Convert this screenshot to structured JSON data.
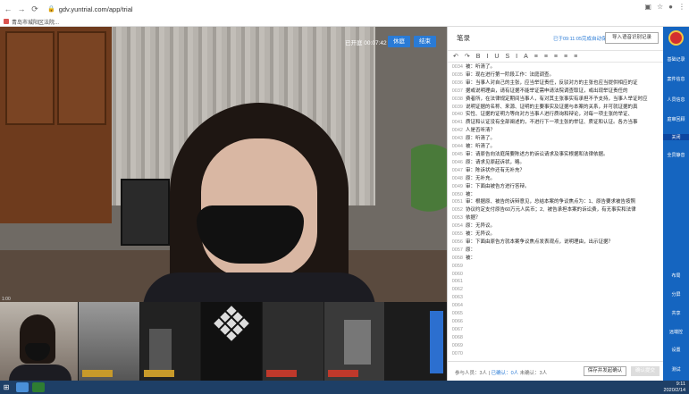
{
  "browser": {
    "url": "gdv.yuntrial.com/app/trial",
    "bookmark": "青岛市城阳区法院..."
  },
  "video": {
    "timestamp": "已开庭 00:07:42",
    "pause_label": "休庭",
    "end_label": "结束",
    "coord": "1:00"
  },
  "thumbnails": [
    {
      "tag": ""
    },
    {
      "tag": ""
    },
    {
      "tag": ""
    },
    {
      "tag": ""
    },
    {
      "tag": ""
    },
    {
      "tag": ""
    },
    {
      "tag": ""
    }
  ],
  "transcript": {
    "title": "笔录",
    "save_note": "已于09:11:05完成自动保存",
    "import_label": "导入语音识别记录",
    "toolbar": [
      "↶",
      "↷",
      "B",
      "I",
      "U",
      "S",
      "I",
      "A",
      "≡",
      "≡",
      "≡",
      "≡",
      "≡"
    ],
    "lines": [
      {
        "n": "0034",
        "t": "被：听清了。"
      },
      {
        "n": "0035",
        "t": "审：现在进行第一阶段工作：法庭调查。"
      },
      {
        "n": "0036",
        "t": "审：当事人对自己的主张，应当举证责任，反驳对方的主张也应当提供相应的证"
      },
      {
        "n": "0037",
        "t": "据或说明理由，请有证据不能举证需申请法院调查取证，或出现举证责任的"
      },
      {
        "n": "0038",
        "t": "费者所，在法律规定期间当事人，有对其主张事实有承担不予支持，当事人举证时应"
      },
      {
        "n": "0039",
        "t": "说明证据的名称、来源、证明的主要事实及证据与本案的关系，并可就证据的真"
      },
      {
        "n": "0040",
        "t": "实性、证据的证明力等向对方当事人进行质询和辩论，对每一项主张的举证、"
      },
      {
        "n": "0041",
        "t": "质证和认证没有全部阐述的，不进行下一项主张的举证、质证和认证。各方当事"
      },
      {
        "n": "0042",
        "t": "人是否听清？"
      },
      {
        "n": "0043",
        "t": "原：听清了。"
      },
      {
        "n": "0044",
        "t": "被：听清了。"
      },
      {
        "n": "0045",
        "t": "审：请原告向法庭简要陈述方的诉讼请求及事实根据和法律依据。"
      },
      {
        "n": "0046",
        "t": "原：请求见原起诉状，略。"
      },
      {
        "n": "0047",
        "t": "审：陈诉状作还有无补充？"
      },
      {
        "n": "0048",
        "t": "原：无补充。"
      },
      {
        "n": "0049",
        "t": "审：下面由被告方进行答辩。"
      },
      {
        "n": "0050",
        "t": "被："
      },
      {
        "n": "0051",
        "t": "审：根据原、被告的诉辩意见，总结本案的争议焦点为：1、原告要求被告按照"
      },
      {
        "n": "0052",
        "t": "协议约定支付原告60万元人民币；2、被告承担本案的诉讼费，有无事实和法律"
      },
      {
        "n": "0053",
        "t": "依据？"
      },
      {
        "n": "0054",
        "t": "原：无异议。"
      },
      {
        "n": "0055",
        "t": "被：无异议。"
      },
      {
        "n": "0056",
        "t": "审：下面由原告方就本案争议焦点发表观点，说明理由，出示证据？"
      },
      {
        "n": "0057",
        "t": "原："
      },
      {
        "n": "0058",
        "t": "被："
      },
      {
        "n": "0059",
        "t": ""
      },
      {
        "n": "0060",
        "t": ""
      },
      {
        "n": "0061",
        "t": ""
      },
      {
        "n": "0062",
        "t": ""
      },
      {
        "n": "0063",
        "t": ""
      },
      {
        "n": "0064",
        "t": ""
      },
      {
        "n": "0065",
        "t": ""
      },
      {
        "n": "0066",
        "t": ""
      },
      {
        "n": "0067",
        "t": ""
      },
      {
        "n": "0068",
        "t": ""
      },
      {
        "n": "0069",
        "t": ""
      },
      {
        "n": "0070",
        "t": ""
      }
    ],
    "footer": {
      "participants_label": "参与人员：3人",
      "signed_label": "已确认：0人",
      "unsigned_label": "未确认：3人",
      "save_button": "保存并发起确认",
      "confirm_button": "确认提交"
    }
  },
  "sidebar": {
    "items": [
      {
        "label": "基础记录"
      },
      {
        "label": "案件信息"
      },
      {
        "label": "人员信息"
      },
      {
        "label": "庭审回顾"
      },
      {
        "label": "关闭"
      },
      {
        "label": "全员静音"
      },
      {
        "label": "布局"
      },
      {
        "label": "分屏"
      },
      {
        "label": "共享"
      },
      {
        "label": "远端控"
      },
      {
        "label": "设置"
      },
      {
        "label": "测试"
      }
    ]
  },
  "taskbar": {
    "time": "9:11",
    "date": "2020/2/14"
  },
  "colors": {
    "accent": "#2a7bd6",
    "sidebar": "#1565c0",
    "taskbar": "#1e3f66"
  }
}
